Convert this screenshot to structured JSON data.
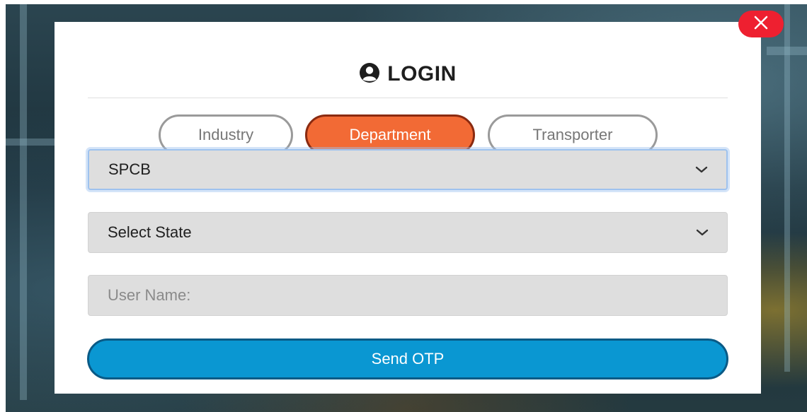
{
  "login": {
    "title": "LOGIN",
    "title_icon": "user-circle-icon",
    "close_icon": "close-icon"
  },
  "tabs": [
    {
      "label": "Industry",
      "active": false
    },
    {
      "label": "Department",
      "active": true
    },
    {
      "label": "Transporter",
      "active": false
    }
  ],
  "form": {
    "category_select": {
      "value": "SPCB",
      "icon": "chevron-down-icon"
    },
    "state_select": {
      "value": "Select State",
      "icon": "chevron-down-icon"
    },
    "username": {
      "placeholder": "User Name:",
      "value": ""
    },
    "submit_label": "Send OTP"
  },
  "colors": {
    "active_tab": "#f26a35",
    "submit": "#0a97d2",
    "close": "#ee2030"
  }
}
